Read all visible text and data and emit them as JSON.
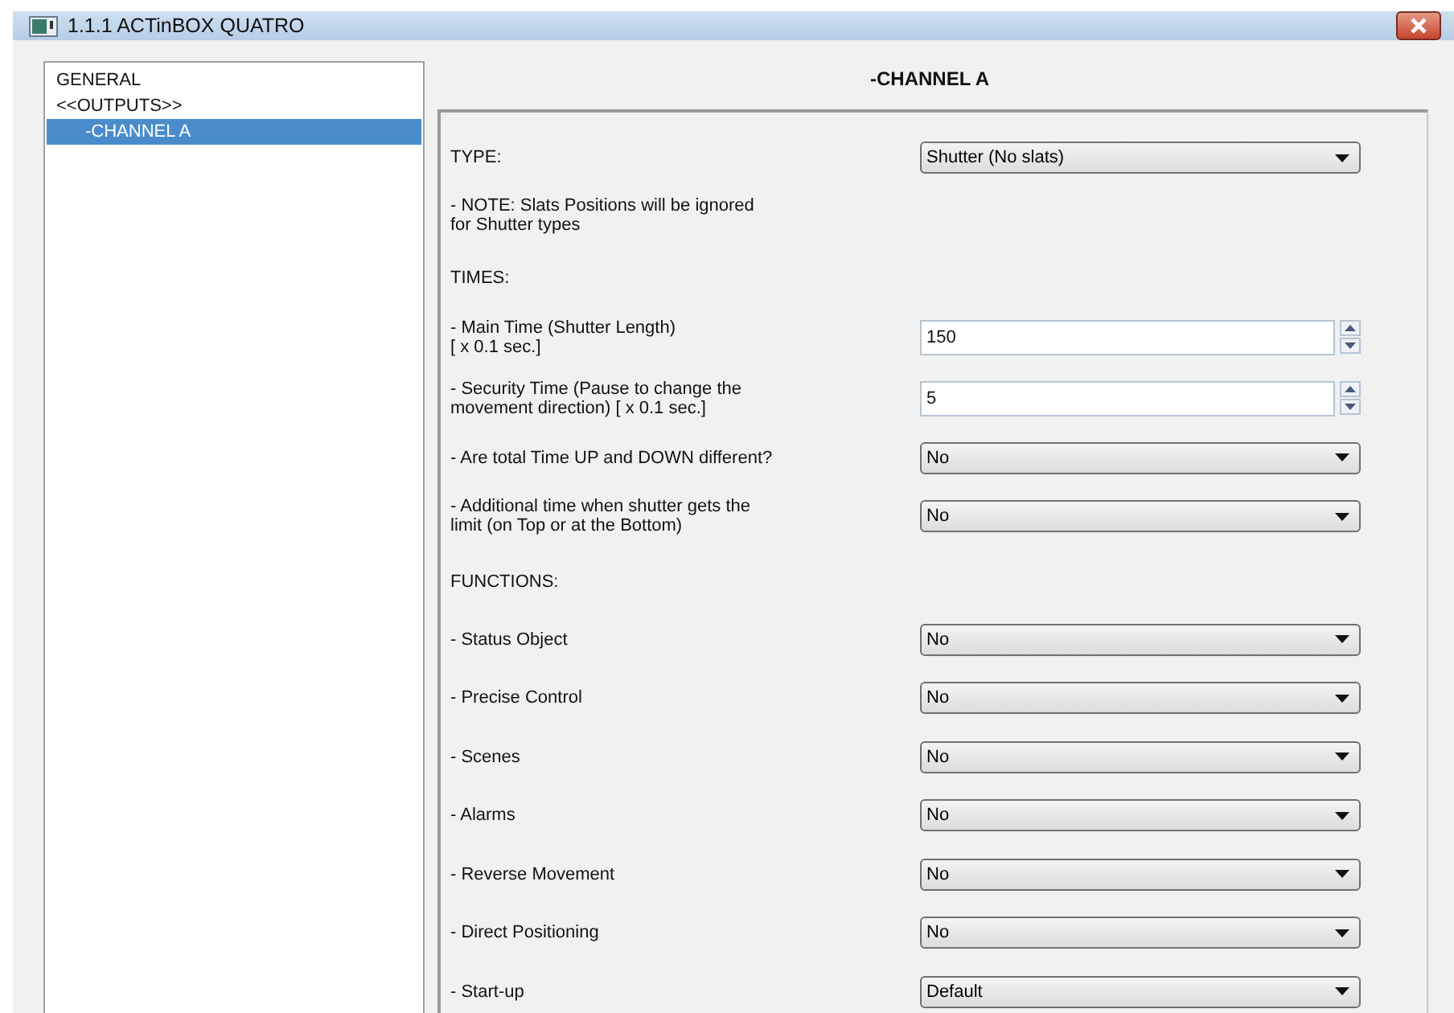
{
  "window": {
    "title": "1.1.1 ACTinBOX QUATRO"
  },
  "tree": [
    {
      "label": "GENERAL",
      "selected": false
    },
    {
      "label": "<<OUTPUTS>>",
      "selected": false,
      "children": [
        {
          "label": "-CHANNEL A",
          "selected": true
        }
      ]
    }
  ],
  "page_title": "-CHANNEL A",
  "rows": [
    {
      "kind": "dropdown",
      "label": "TYPE:",
      "value": "Shutter (No slats)"
    },
    {
      "kind": "note",
      "label": "- NOTE: Slats Positions will be ignored\n  for Shutter types"
    },
    {
      "kind": "heading",
      "label": "TIMES:"
    },
    {
      "kind": "spin",
      "label": "- Main Time (Shutter Length)\n  [ x 0.1 sec.]",
      "value": "150"
    },
    {
      "kind": "spin",
      "label": "- Security Time (Pause to change the\n  movement direction) [ x 0.1 sec.]",
      "value": "5"
    },
    {
      "kind": "dropdown",
      "label": "- Are total Time UP and DOWN different?",
      "value": "No"
    },
    {
      "kind": "dropdown",
      "label": "- Additional time when shutter gets the\n  limit (on Top or at the Bottom)",
      "value": "No"
    },
    {
      "kind": "heading",
      "label": "FUNCTIONS:"
    },
    {
      "kind": "dropdown",
      "label": " - Status Object",
      "value": "No"
    },
    {
      "kind": "dropdown",
      "label": " - Precise Control",
      "value": "No"
    },
    {
      "kind": "dropdown",
      "label": " - Scenes",
      "value": "No"
    },
    {
      "kind": "dropdown",
      "label": " - Alarms",
      "value": "No"
    },
    {
      "kind": "dropdown",
      "label": " - Reverse Movement",
      "value": "No"
    },
    {
      "kind": "dropdown",
      "label": " - Direct Positioning",
      "value": "No"
    },
    {
      "kind": "dropdown",
      "label": " - Start-up",
      "value": "Default"
    }
  ]
}
